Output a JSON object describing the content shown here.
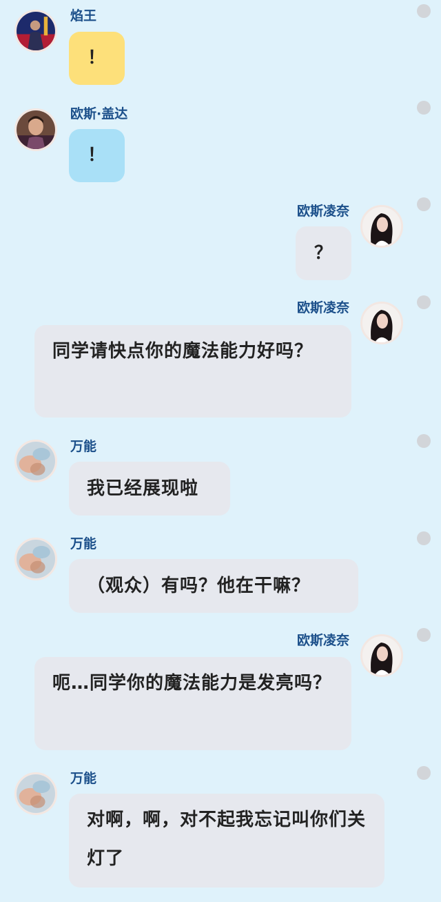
{
  "messages": [
    {
      "sender": "焰王",
      "text": "！",
      "side": "left",
      "bubble_color": "#fde07a",
      "avatar_icon": "avatar-flame-king"
    },
    {
      "sender": "欧斯·盖达",
      "text": "！",
      "side": "left",
      "bubble_color": "#a9e0f7",
      "avatar_icon": "avatar-man"
    },
    {
      "sender": "欧斯凌奈",
      "text": "？",
      "side": "right",
      "bubble_color": "#e6e8ee",
      "avatar_icon": "avatar-woman"
    },
    {
      "sender": "欧斯凌奈",
      "text": "同学请快点你的魔法能力好吗？",
      "side": "right",
      "bubble_color": "#e6e8ee",
      "avatar_icon": "avatar-woman"
    },
    {
      "sender": "万能",
      "text": "我已经展现啦",
      "side": "left",
      "bubble_color": "#e6e8ee",
      "avatar_icon": "avatar-hazy"
    },
    {
      "sender": "万能",
      "text": "（观众）有吗？他在干嘛？",
      "side": "left",
      "bubble_color": "#e6e8ee",
      "avatar_icon": "avatar-hazy"
    },
    {
      "sender": "欧斯凌奈",
      "text": "呃…同学你的魔法能力是发亮吗？",
      "side": "right",
      "bubble_color": "#e6e8ee",
      "avatar_icon": "avatar-woman"
    },
    {
      "sender": "万能",
      "text": "对啊，啊，对不起我忘记叫你们关灯了",
      "side": "left",
      "bubble_color": "#e6e8ee",
      "avatar_icon": "avatar-hazy"
    }
  ],
  "colors": {
    "background": "#dff2fb",
    "name": "#1b4f8a",
    "dot": "#d2d5d9"
  }
}
